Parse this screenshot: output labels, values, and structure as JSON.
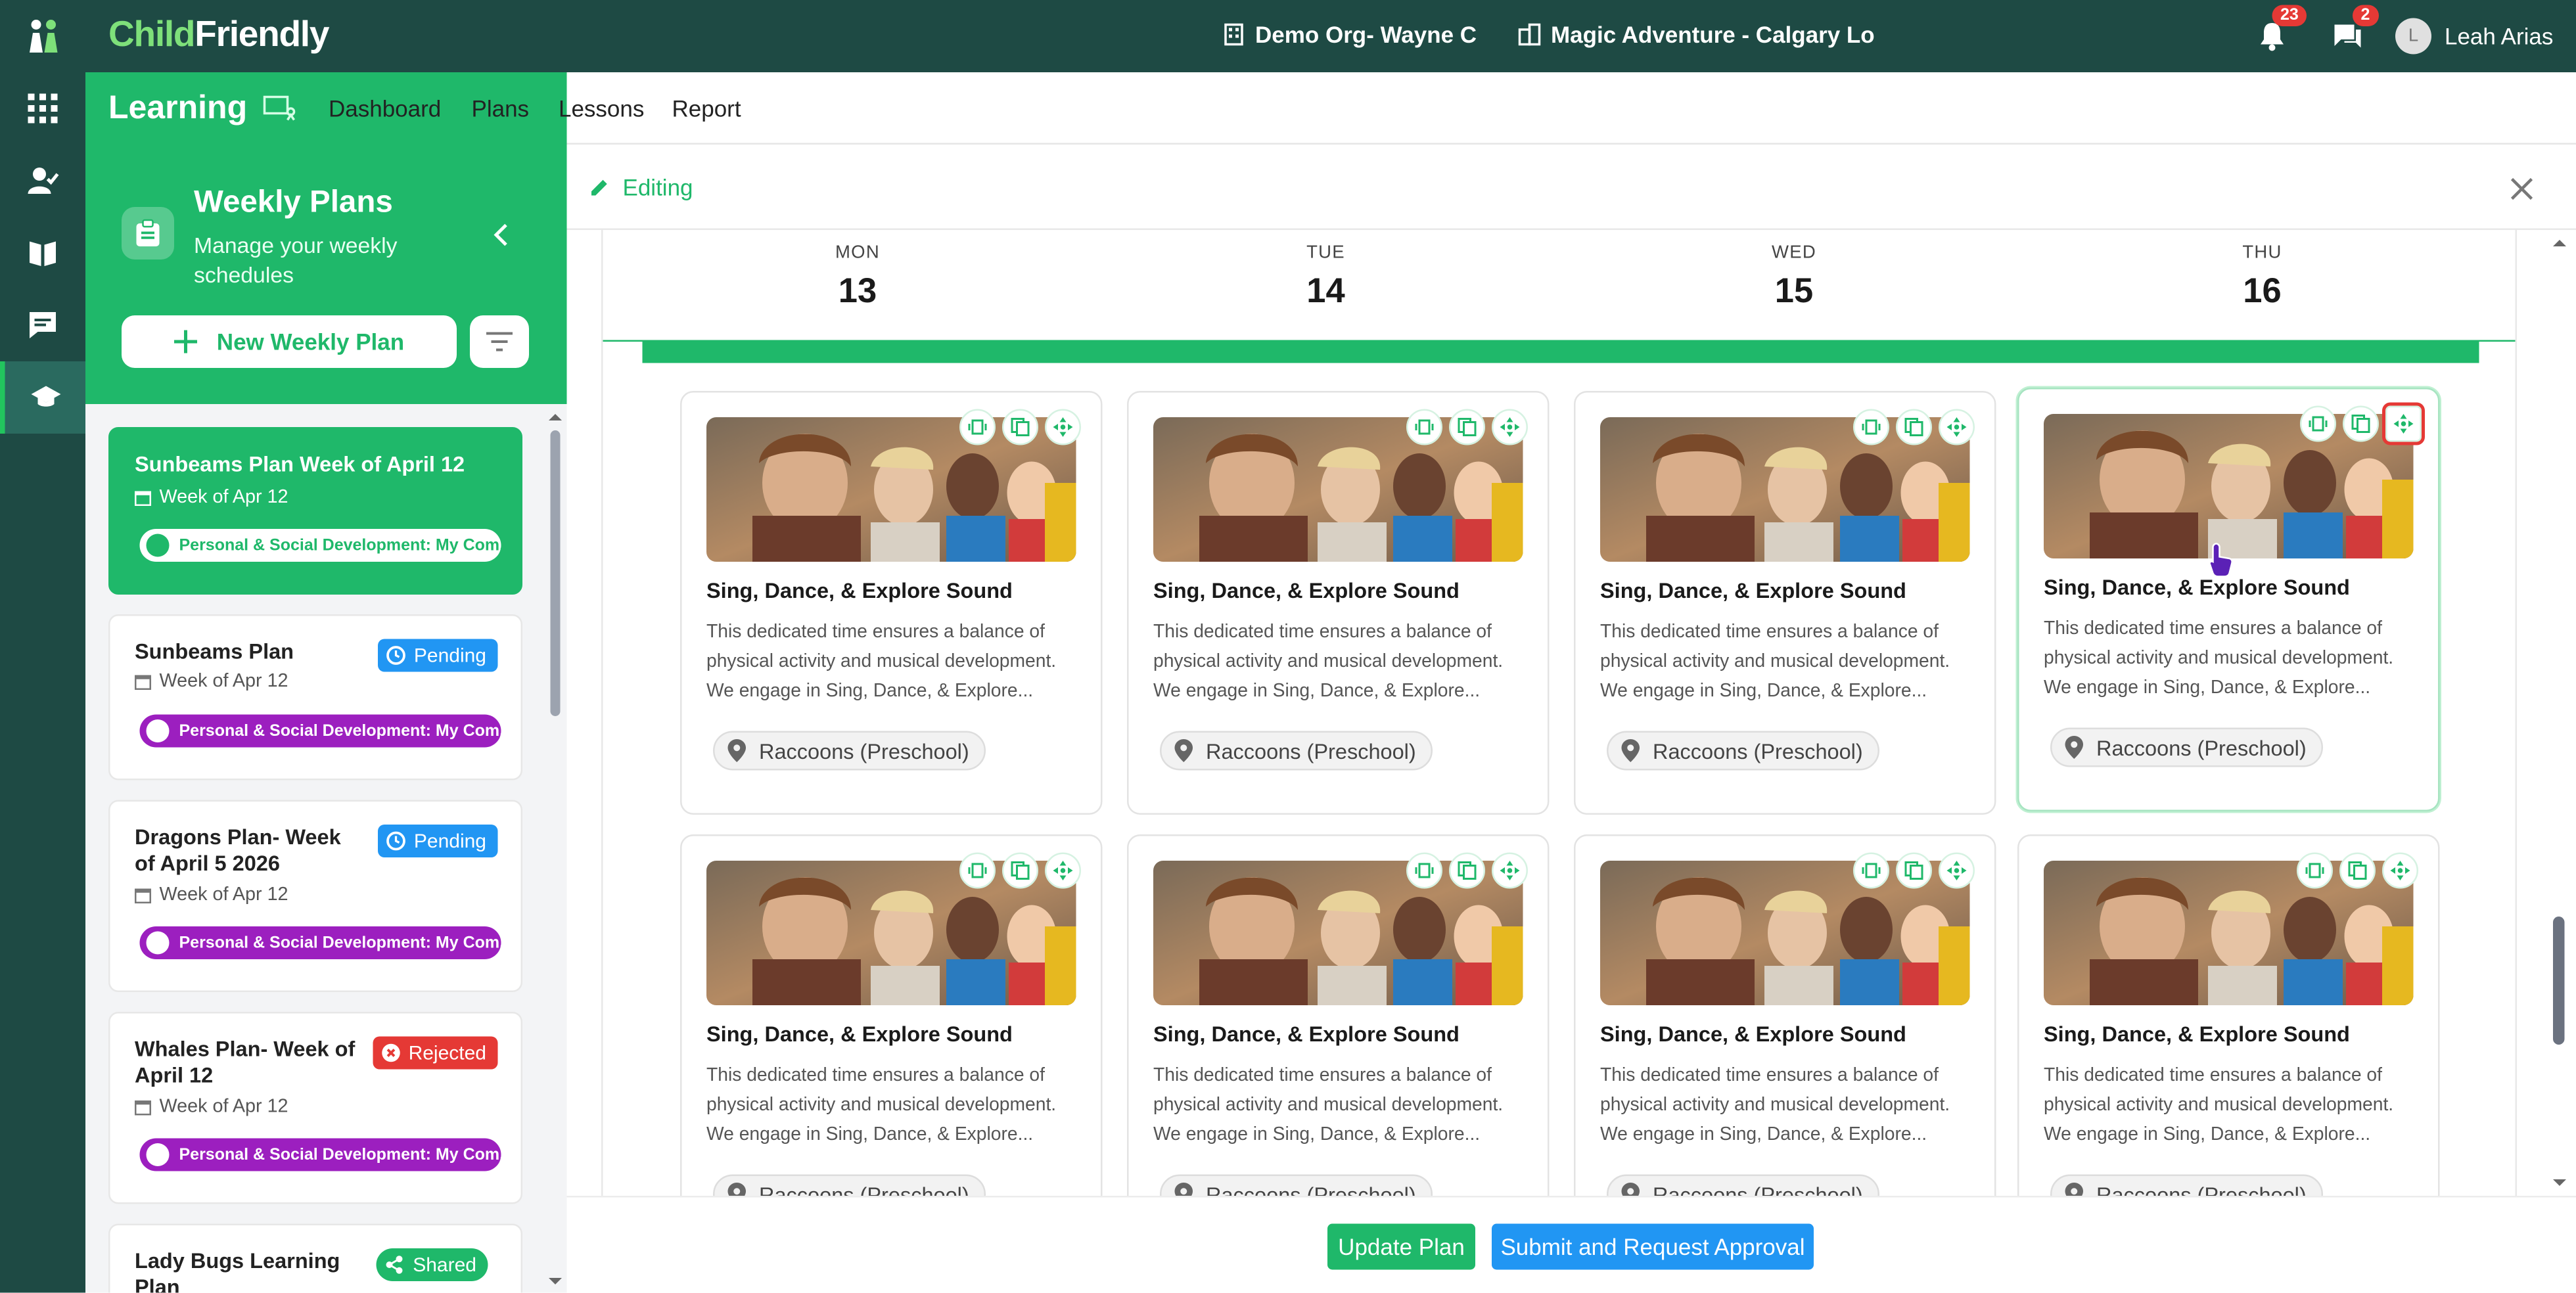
{
  "app": {
    "brand_part1": "Child",
    "brand_part2": "Friendly",
    "org": "Demo Org- Wayne C",
    "location": "Magic Adventure - Calgary Lo",
    "notifications_count": "23",
    "messages_count": "2",
    "user_initial": "L",
    "user_name": "Leah Arias"
  },
  "module": {
    "title": "Learning",
    "tabs": [
      "Dashboard",
      "Plans",
      "Lessons",
      "Report"
    ],
    "active_tab": "Plans"
  },
  "sidebar": {
    "title": "Weekly Plans",
    "subtitle": "Manage your weekly schedules",
    "new_button": "New Weekly Plan",
    "plans": [
      {
        "title": "Sunbeams Plan Week of April 12",
        "week": "Week of Apr 12",
        "tag": "Personal & Social Development: My Com...",
        "status": ""
      },
      {
        "title": "Sunbeams Plan",
        "week": "Week of Apr 12",
        "tag": "Personal & Social Development: My Com...",
        "status": "Pending"
      },
      {
        "title": "Dragons Plan- Week of April 5 2026",
        "week": "Week of Apr 12",
        "tag": "Personal & Social Development: My Com...",
        "status": "Pending"
      },
      {
        "title": "Whales Plan- Week of April 12",
        "week": "Week of Apr 12",
        "tag": "Personal & Social Development: My Com...",
        "status": "Rejected"
      },
      {
        "title": "Lady Bugs Learning Plan",
        "week": "",
        "tag": "",
        "status": "Shared"
      }
    ]
  },
  "editor": {
    "mode_label": "Editing",
    "days": [
      {
        "name": "MON",
        "num": "13"
      },
      {
        "name": "TUE",
        "num": "14"
      },
      {
        "name": "WED",
        "num": "15"
      },
      {
        "name": "THU",
        "num": "16"
      }
    ],
    "activity": {
      "title": "Sing, Dance, & Explore Sound",
      "description": "This dedicated time ensures a balance of physical activity and musical development. We engage in Sing, Dance, & Explore...",
      "location": "Raccoons (Preschool)"
    },
    "update_button": "Update Plan",
    "submit_button": "Submit and Request Approval"
  },
  "colors": {
    "brand_dark": "#1e4a44",
    "accent_green": "#1fb86a",
    "pending_blue": "#2196f3",
    "rejected_red": "#e53935",
    "tag_purple": "#9c1fbf"
  }
}
